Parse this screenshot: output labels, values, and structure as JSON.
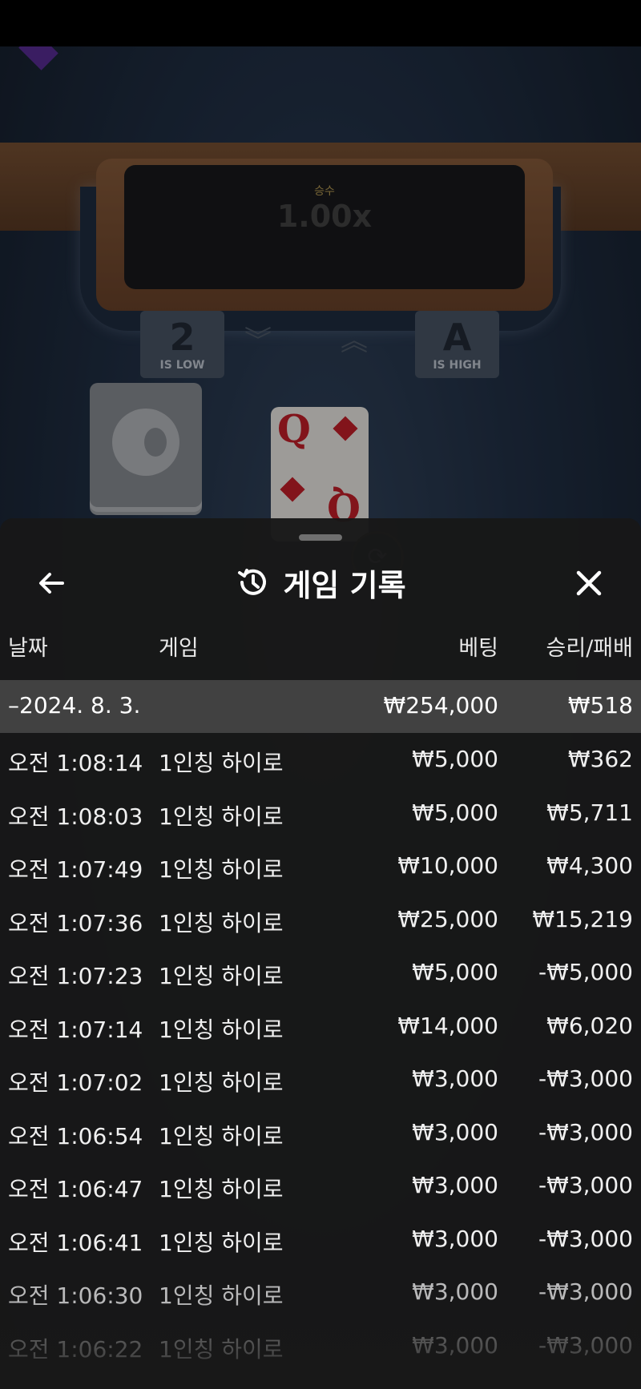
{
  "game_table": {
    "multiplier_label": "승수",
    "multiplier_value": "1.00x",
    "low_tile": {
      "rank": "2",
      "caption": "IS LOW"
    },
    "high_tile": {
      "rank": "A",
      "caption": "IS HIGH"
    },
    "current_card": {
      "rank": "Q",
      "suit": "diamonds"
    },
    "accent_color": "#c8202a"
  },
  "panel": {
    "title": "게임 기록",
    "icons": {
      "back": "arrow-left-icon",
      "history": "history-icon",
      "close": "close-icon"
    }
  },
  "table": {
    "headers": {
      "date": "날짜",
      "game": "게임",
      "bet": "베팅",
      "win_loss": "승리/패배"
    },
    "summary": {
      "date": "–2024. 8. 3.",
      "bet": "₩254,000",
      "win_loss": "₩518"
    },
    "rows": [
      {
        "time": "오전 1:08:14",
        "game": "1인칭 하이로",
        "bet": "₩5,000",
        "win_loss": "₩362"
      },
      {
        "time": "오전 1:08:03",
        "game": "1인칭 하이로",
        "bet": "₩5,000",
        "win_loss": "₩5,711"
      },
      {
        "time": "오전 1:07:49",
        "game": "1인칭 하이로",
        "bet": "₩10,000",
        "win_loss": "₩4,300"
      },
      {
        "time": "오전 1:07:36",
        "game": "1인칭 하이로",
        "bet": "₩25,000",
        "win_loss": "₩15,219"
      },
      {
        "time": "오전 1:07:23",
        "game": "1인칭 하이로",
        "bet": "₩5,000",
        "win_loss": "-₩5,000"
      },
      {
        "time": "오전 1:07:14",
        "game": "1인칭 하이로",
        "bet": "₩14,000",
        "win_loss": "₩6,020"
      },
      {
        "time": "오전 1:07:02",
        "game": "1인칭 하이로",
        "bet": "₩3,000",
        "win_loss": "-₩3,000"
      },
      {
        "time": "오전 1:06:54",
        "game": "1인칭 하이로",
        "bet": "₩3,000",
        "win_loss": "-₩3,000"
      },
      {
        "time": "오전 1:06:47",
        "game": "1인칭 하이로",
        "bet": "₩3,000",
        "win_loss": "-₩3,000"
      },
      {
        "time": "오전 1:06:41",
        "game": "1인칭 하이로",
        "bet": "₩3,000",
        "win_loss": "-₩3,000"
      },
      {
        "time": "오전 1:06:30",
        "game": "1인칭 하이로",
        "bet": "₩3,000",
        "win_loss": "-₩3,000"
      },
      {
        "time": "오전 1:06:22",
        "game": "1인칭 하이로",
        "bet": "₩3,000",
        "win_loss": "-₩3,000"
      }
    ]
  }
}
